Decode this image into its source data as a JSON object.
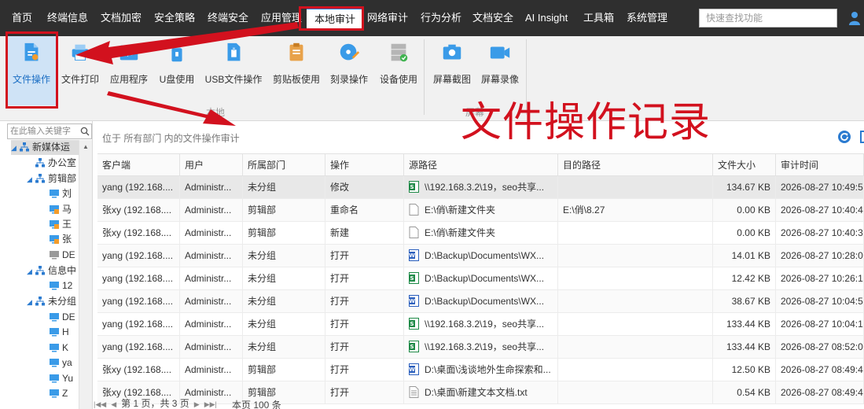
{
  "nav": {
    "items": [
      "首页",
      "终端信息",
      "文档加密",
      "安全策略",
      "终端安全",
      "应用管理",
      "本地审计",
      "网络审计",
      "行为分析",
      "文档安全",
      "AI Insight",
      "工具箱",
      "系统管理"
    ],
    "active_index": 6,
    "search_placeholder": "快速查找功能"
  },
  "ribbon": {
    "buttons": [
      "文件操作",
      "文件打印",
      "应用程序",
      "U盘使用",
      "USB文件操作",
      "剪贴板使用",
      "刻录操作",
      "设备使用",
      "屏幕截图",
      "屏幕录像"
    ],
    "selected_index": 0,
    "groups": [
      "本地",
      "屏幕"
    ]
  },
  "tree": {
    "search_placeholder": "在此输入关键字",
    "nodes": [
      {
        "label": "新媒体运",
        "icon": "org-icon",
        "level": 0,
        "expanded": true,
        "selected": true
      },
      {
        "label": "办公室",
        "icon": "org-icon",
        "level": 1,
        "expanded": false
      },
      {
        "label": "剪辑部",
        "icon": "org-icon",
        "level": 1,
        "expanded": true
      },
      {
        "label": "刘",
        "icon": "computer-icon",
        "level": 2
      },
      {
        "label": "马",
        "icon": "computer-locked-icon",
        "level": 2
      },
      {
        "label": "王",
        "icon": "computer-locked-icon",
        "level": 2
      },
      {
        "label": "张",
        "icon": "computer-locked-icon",
        "level": 2
      },
      {
        "label": "DE",
        "icon": "computer-offline-icon",
        "level": 2
      },
      {
        "label": "信息中",
        "icon": "org-icon",
        "level": 1,
        "expanded": true
      },
      {
        "label": "12",
        "icon": "computer-icon",
        "level": 2
      },
      {
        "label": "未分组",
        "icon": "org-icon",
        "level": 1,
        "expanded": true
      },
      {
        "label": "DE",
        "icon": "computer-icon",
        "level": 2
      },
      {
        "label": "H",
        "icon": "computer-icon",
        "level": 2
      },
      {
        "label": "K",
        "icon": "computer-icon",
        "level": 2
      },
      {
        "label": "ya",
        "icon": "computer-icon",
        "level": 2
      },
      {
        "label": "Yu",
        "icon": "computer-icon",
        "level": 2
      },
      {
        "label": "Z",
        "icon": "computer-icon",
        "level": 2
      }
    ]
  },
  "breadcrumb": "位于 所有部门 内的文件操作审计",
  "table": {
    "columns": [
      "客户端",
      "用户",
      "所属部门",
      "操作",
      "源路径",
      "目的路径",
      "文件大小",
      "审计时间"
    ],
    "rows": [
      {
        "client": "yang (192.168....",
        "user": "Administr...",
        "dept": "未分组",
        "op": "修改",
        "src_icon": "excel-file-icon",
        "src": "\\\\192.168.3.2\\19，seo共享...",
        "dst": "",
        "size": "134.67 KB",
        "time": "2026-08-27 10:49:5"
      },
      {
        "client": "张xy (192.168....",
        "user": "Administr...",
        "dept": "剪辑部",
        "op": "重命名",
        "src_icon": "blank-file-icon",
        "src": "E:\\俏\\新建文件夹",
        "dst": "E:\\俏\\8.27",
        "size": "0.00 KB",
        "time": "2026-08-27 10:40:4"
      },
      {
        "client": "张xy (192.168....",
        "user": "Administr...",
        "dept": "剪辑部",
        "op": "新建",
        "src_icon": "blank-file-icon",
        "src": "E:\\俏\\新建文件夹",
        "dst": "",
        "size": "0.00 KB",
        "time": "2026-08-27 10:40:3"
      },
      {
        "client": "yang (192.168....",
        "user": "Administr...",
        "dept": "未分组",
        "op": "打开",
        "src_icon": "word-file-icon",
        "src": "D:\\Backup\\Documents\\WX...",
        "dst": "",
        "size": "14.01 KB",
        "time": "2026-08-27 10:28:0"
      },
      {
        "client": "yang (192.168....",
        "user": "Administr...",
        "dept": "未分组",
        "op": "打开",
        "src_icon": "excel-file-icon",
        "src": "D:\\Backup\\Documents\\WX...",
        "dst": "",
        "size": "12.42 KB",
        "time": "2026-08-27 10:26:1"
      },
      {
        "client": "yang (192.168....",
        "user": "Administr...",
        "dept": "未分组",
        "op": "打开",
        "src_icon": "word-file-icon",
        "src": "D:\\Backup\\Documents\\WX...",
        "dst": "",
        "size": "38.67 KB",
        "time": "2026-08-27 10:04:5"
      },
      {
        "client": "yang (192.168....",
        "user": "Administr...",
        "dept": "未分组",
        "op": "打开",
        "src_icon": "excel-file-icon",
        "src": "\\\\192.168.3.2\\19，seo共享...",
        "dst": "",
        "size": "133.44 KB",
        "time": "2026-08-27 10:04:1"
      },
      {
        "client": "yang (192.168....",
        "user": "Administr...",
        "dept": "未分组",
        "op": "打开",
        "src_icon": "excel-file-icon",
        "src": "\\\\192.168.3.2\\19，seo共享...",
        "dst": "",
        "size": "133.44 KB",
        "time": "2026-08-27 08:52:0"
      },
      {
        "client": "张xy (192.168....",
        "user": "Administr...",
        "dept": "剪辑部",
        "op": "打开",
        "src_icon": "word-file-icon",
        "src": "D:\\桌面\\浅谈地外生命探索和...",
        "dst": "",
        "size": "12.50 KB",
        "time": "2026-08-27 08:49:4"
      },
      {
        "client": "张xy (192.168....",
        "user": "Administr...",
        "dept": "剪辑部",
        "op": "打开",
        "src_icon": "text-file-icon",
        "src": "D:\\桌面\\新建文本文档.txt",
        "dst": "",
        "size": "0.54 KB",
        "time": "2026-08-27 08:49:4"
      }
    ]
  },
  "pager": {
    "page_text": "第 1 页，共 3 页",
    "count_text": "本页 100 条"
  },
  "callout": "文件操作记录",
  "colors": {
    "annotation_red": "#d2111e",
    "accent_blue": "#2b7bd0",
    "nav_bg": "#2f2f2f"
  }
}
